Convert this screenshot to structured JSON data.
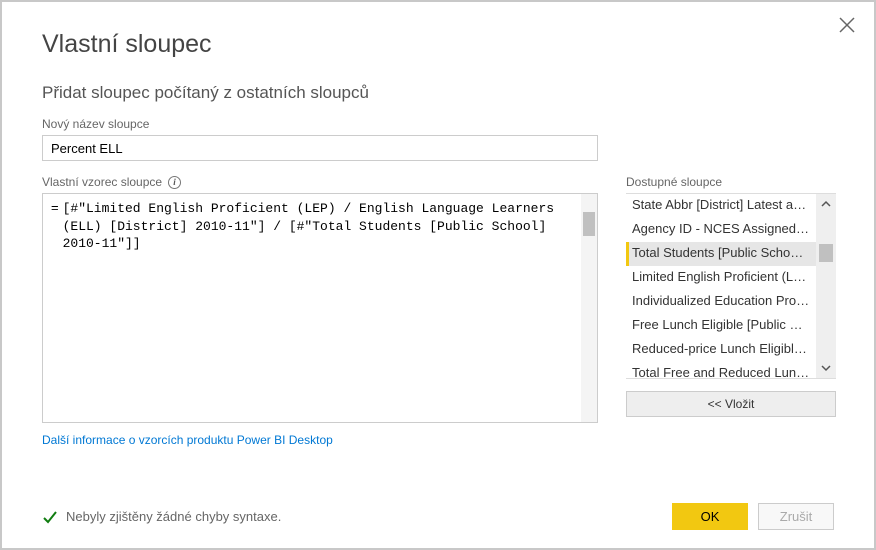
{
  "header": {
    "title": "Vlastní sloupec",
    "subtitle": "Přidat sloupec počítaný z ostatních sloupců"
  },
  "new_column": {
    "label": "Nový název sloupce",
    "value": "Percent ELL"
  },
  "formula": {
    "label": "Vlastní vzorec sloupce",
    "prefix": "=",
    "text": "[#\"Limited English Proficient (LEP) / English Language Learners (ELL) [District] 2010-11\"] / [#\"Total Students [Public School] 2010-11\"]]",
    "learn_more": "Další informace o vzorcích produktu Power BI Desktop"
  },
  "available": {
    "label": "Dostupné sloupce",
    "items": [
      "State Abbr [District] Latest av…",
      "Agency ID - NCES Assigned […",
      "Total Students [Public School…",
      "Limited English Proficient (LE…",
      "Individualized Education Prog…",
      "Free Lunch Eligible [Public Sc…",
      "Reduced-price Lunch Eligible…",
      "Total Free and Reduced Lunc…"
    ],
    "selected_index": 2,
    "insert_label": "<< Vložit"
  },
  "status": {
    "text": "Nebyly zjištěny žádné chyby syntaxe."
  },
  "buttons": {
    "ok": "OK",
    "cancel": "Zrušit"
  }
}
